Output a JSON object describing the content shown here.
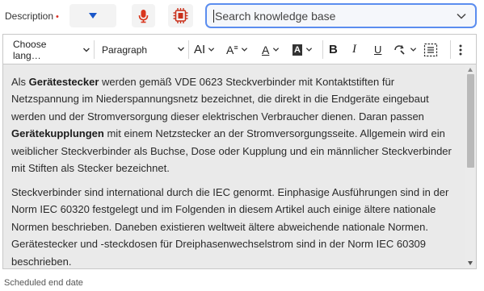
{
  "description_field": {
    "label": "Description",
    "required_marker": "•"
  },
  "search": {
    "placeholder": "Search knowledge base",
    "value": ""
  },
  "toolbar": {
    "language_label": "Choose lang…",
    "paragraph_label": "Paragraph",
    "font_size_label": "AI",
    "font_style_label": "A",
    "underline_color_label": "A",
    "highlight_label": "A",
    "bold_label": "B",
    "italic_label": "I",
    "underline_label": "U"
  },
  "content": {
    "paragraph1": {
      "t1": "Als ",
      "b1": "Gerätestecker",
      "t2": " werden gemäß VDE 0623 Steckverbinder mit Kontaktstiften für Netzspannung im Niederspannungsnetz bezeichnet, die direkt in die Endgeräte eingebaut werden und der Stromversorgung dieser elektrischen Verbraucher dienen. Daran passen ",
      "b2": "Gerätekupplungen",
      "t3": " mit einem Netzstecker an der Stromversorgungsseite. Allgemein wird ein weiblicher Steckverbinder als Buchse, Dose oder Kupplung und ein männlicher Steckverbinder mit Stiften als Stecker bezeichnet."
    },
    "paragraph2": "Steckverbinder sind international durch die IEC genormt. Einphasige Ausführungen sind in der Norm IEC 60320 festgelegt und im Folgenden in diesem Artikel auch einige ältere nationale Normen beschrieben. Daneben existieren weltweit ältere abweichende nationale Normen. Gerätestecker und -steckdosen für Dreiphasenwechselstrom sind in der Norm IEC 60309 beschrieben."
  },
  "scheduled_end_date": {
    "label": "Scheduled end date"
  },
  "icons": {
    "mic": "microphone-icon",
    "chip": "chip-icon",
    "chevron": "chevron-down-icon",
    "more": "more-vertical-icon"
  },
  "colors": {
    "accent": "#1a57c9",
    "search_border": "#5b8def",
    "mic": "#d9361d",
    "chip": "#c9301b",
    "required": "#d93025",
    "editor_bg": "#eaeaea"
  }
}
